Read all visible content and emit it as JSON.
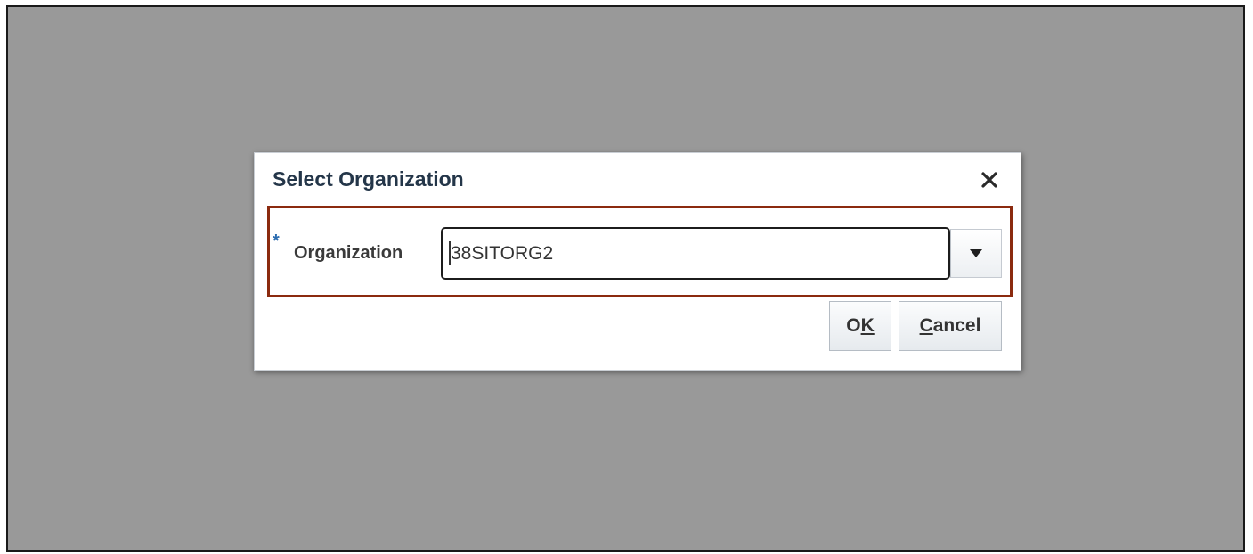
{
  "dialog": {
    "title": "Select Organization",
    "close_icon": "close-icon"
  },
  "organization_field": {
    "required_marker": "*",
    "label": "Organization",
    "value": "38SITORG2",
    "dropdown_icon": "triangle-down-icon"
  },
  "buttons": {
    "ok": {
      "pre": "O",
      "mnemonic": "K",
      "post": ""
    },
    "cancel": {
      "pre": "",
      "mnemonic": "C",
      "post": "ancel"
    }
  },
  "colors": {
    "overlay": "#999999",
    "title": "#243649",
    "highlight_border": "#8b2a0f",
    "required_star": "#2b6cb0"
  }
}
